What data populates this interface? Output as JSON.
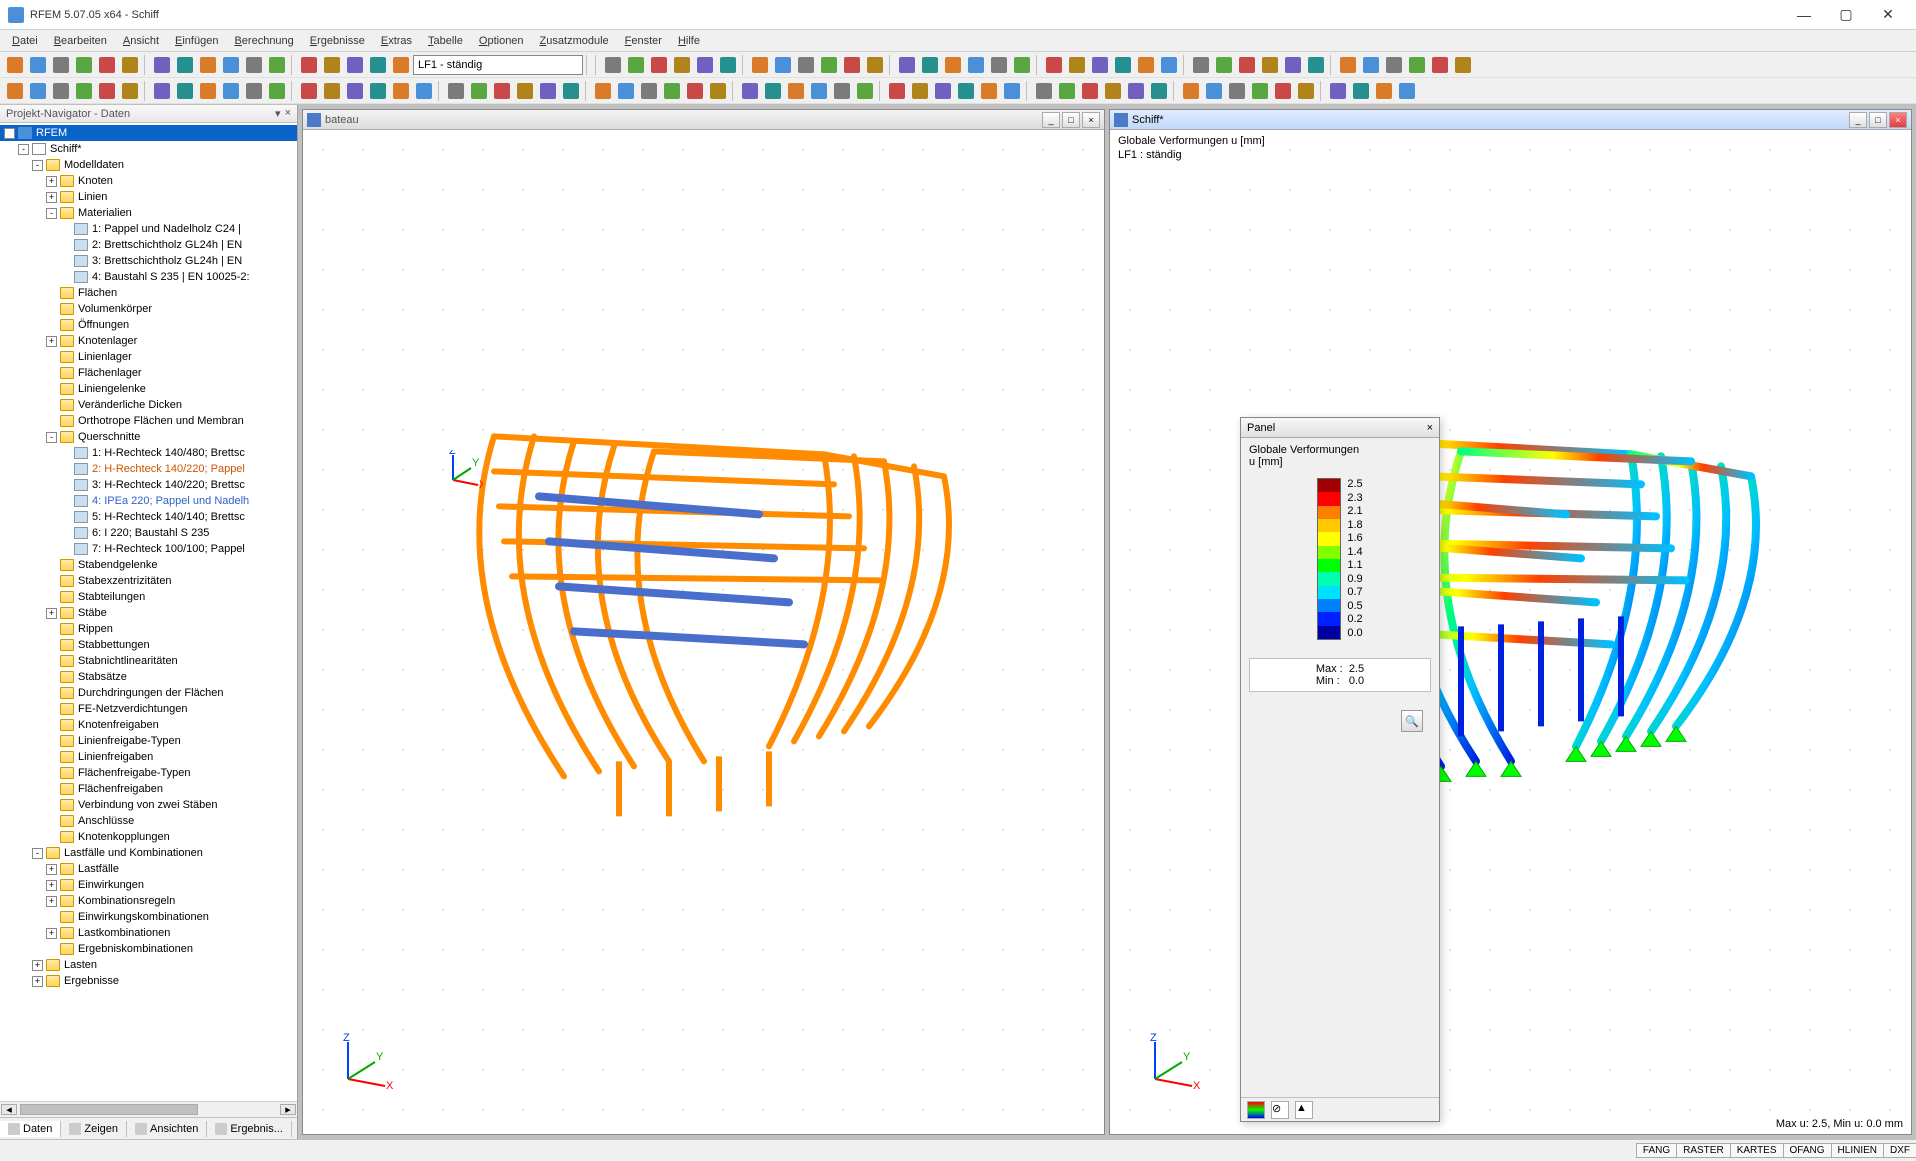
{
  "app": {
    "title": "RFEM 5.07.05 x64 - Schiff"
  },
  "menu": [
    "Datei",
    "Bearbeiten",
    "Ansicht",
    "Einfügen",
    "Berechnung",
    "Ergebnisse",
    "Extras",
    "Tabelle",
    "Optionen",
    "Zusatzmodule",
    "Fenster",
    "Hilfe"
  ],
  "toolbar_combo": "LF1 - ständig",
  "navigator": {
    "title": "Projekt-Navigator - Daten",
    "tabs": [
      "Daten",
      "Zeigen",
      "Ansichten",
      "Ergebnis..."
    ],
    "tree": [
      {
        "d": 0,
        "t": "-",
        "icon": "rfem",
        "label": "RFEM",
        "sel": true
      },
      {
        "d": 1,
        "t": "-",
        "icon": "model",
        "label": "Schiff*"
      },
      {
        "d": 2,
        "t": "-",
        "icon": "folder-open",
        "label": "Modelldaten"
      },
      {
        "d": 3,
        "t": "+",
        "icon": "folder",
        "label": "Knoten"
      },
      {
        "d": 3,
        "t": "+",
        "icon": "folder",
        "label": "Linien"
      },
      {
        "d": 3,
        "t": "-",
        "icon": "folder-open",
        "label": "Materialien"
      },
      {
        "d": 4,
        "t": "",
        "icon": "leaf",
        "label": "1: Pappel und Nadelholz C24 |"
      },
      {
        "d": 4,
        "t": "",
        "icon": "leaf",
        "label": "2: Brettschichtholz GL24h | EN"
      },
      {
        "d": 4,
        "t": "",
        "icon": "leaf",
        "label": "3: Brettschichtholz GL24h | EN"
      },
      {
        "d": 4,
        "t": "",
        "icon": "leaf",
        "label": "4: Baustahl S 235 | EN 10025-2:"
      },
      {
        "d": 3,
        "t": "",
        "icon": "folder",
        "label": "Flächen"
      },
      {
        "d": 3,
        "t": "",
        "icon": "folder",
        "label": "Volumenkörper"
      },
      {
        "d": 3,
        "t": "",
        "icon": "folder",
        "label": "Öffnungen"
      },
      {
        "d": 3,
        "t": "+",
        "icon": "folder",
        "label": "Knotenlager"
      },
      {
        "d": 3,
        "t": "",
        "icon": "folder",
        "label": "Linienlager"
      },
      {
        "d": 3,
        "t": "",
        "icon": "folder",
        "label": "Flächenlager"
      },
      {
        "d": 3,
        "t": "",
        "icon": "folder",
        "label": "Liniengelenke"
      },
      {
        "d": 3,
        "t": "",
        "icon": "folder",
        "label": "Veränderliche Dicken"
      },
      {
        "d": 3,
        "t": "",
        "icon": "folder",
        "label": "Orthotrope Flächen und Membran"
      },
      {
        "d": 3,
        "t": "-",
        "icon": "folder-open",
        "label": "Querschnitte"
      },
      {
        "d": 4,
        "t": "",
        "icon": "leaf",
        "label": "1: H-Rechteck 140/480; Brettsc"
      },
      {
        "d": 4,
        "t": "",
        "icon": "leaf",
        "label": "2: H-Rechteck 140/220; Pappel",
        "style": "color:#cc5500"
      },
      {
        "d": 4,
        "t": "",
        "icon": "leaf",
        "label": "3: H-Rechteck 140/220; Brettsc"
      },
      {
        "d": 4,
        "t": "",
        "icon": "leaf",
        "label": "4: IPEa 220; Pappel und Nadelh",
        "style": "color:#3060cc"
      },
      {
        "d": 4,
        "t": "",
        "icon": "leaf",
        "label": "5: H-Rechteck 140/140; Brettsc"
      },
      {
        "d": 4,
        "t": "",
        "icon": "leaf",
        "label": "6: I 220; Baustahl S 235"
      },
      {
        "d": 4,
        "t": "",
        "icon": "leaf",
        "label": "7: H-Rechteck 100/100; Pappel"
      },
      {
        "d": 3,
        "t": "",
        "icon": "folder",
        "label": "Stabendgelenke"
      },
      {
        "d": 3,
        "t": "",
        "icon": "folder",
        "label": "Stabexzentrizitäten"
      },
      {
        "d": 3,
        "t": "",
        "icon": "folder",
        "label": "Stabteilungen"
      },
      {
        "d": 3,
        "t": "+",
        "icon": "folder",
        "label": "Stäbe"
      },
      {
        "d": 3,
        "t": "",
        "icon": "folder",
        "label": "Rippen"
      },
      {
        "d": 3,
        "t": "",
        "icon": "folder",
        "label": "Stabbettungen"
      },
      {
        "d": 3,
        "t": "",
        "icon": "folder",
        "label": "Stabnichtlinearitäten"
      },
      {
        "d": 3,
        "t": "",
        "icon": "folder",
        "label": "Stabsätze"
      },
      {
        "d": 3,
        "t": "",
        "icon": "folder",
        "label": "Durchdringungen der Flächen"
      },
      {
        "d": 3,
        "t": "",
        "icon": "folder",
        "label": "FE-Netzverdichtungen"
      },
      {
        "d": 3,
        "t": "",
        "icon": "folder",
        "label": "Knotenfreigaben"
      },
      {
        "d": 3,
        "t": "",
        "icon": "folder",
        "label": "Linienfreigabe-Typen"
      },
      {
        "d": 3,
        "t": "",
        "icon": "folder",
        "label": "Linienfreigaben"
      },
      {
        "d": 3,
        "t": "",
        "icon": "folder",
        "label": "Flächenfreigabe-Typen"
      },
      {
        "d": 3,
        "t": "",
        "icon": "folder",
        "label": "Flächenfreigaben"
      },
      {
        "d": 3,
        "t": "",
        "icon": "folder",
        "label": "Verbindung von zwei Stäben"
      },
      {
        "d": 3,
        "t": "",
        "icon": "folder",
        "label": "Anschlüsse"
      },
      {
        "d": 3,
        "t": "",
        "icon": "folder",
        "label": "Knotenkopplungen"
      },
      {
        "d": 2,
        "t": "-",
        "icon": "folder-open",
        "label": "Lastfälle und Kombinationen"
      },
      {
        "d": 3,
        "t": "+",
        "icon": "folder",
        "label": "Lastfälle"
      },
      {
        "d": 3,
        "t": "+",
        "icon": "folder",
        "label": "Einwirkungen"
      },
      {
        "d": 3,
        "t": "+",
        "icon": "folder",
        "label": "Kombinationsregeln"
      },
      {
        "d": 3,
        "t": "",
        "icon": "folder",
        "label": "Einwirkungskombinationen"
      },
      {
        "d": 3,
        "t": "+",
        "icon": "folder",
        "label": "Lastkombinationen"
      },
      {
        "d": 3,
        "t": "",
        "icon": "folder",
        "label": "Ergebniskombinationen"
      },
      {
        "d": 2,
        "t": "+",
        "icon": "folder",
        "label": "Lasten"
      },
      {
        "d": 2,
        "t": "+",
        "icon": "folder",
        "label": "Ergebnisse"
      }
    ]
  },
  "viewports": {
    "left": {
      "title": "bateau"
    },
    "right": {
      "title": "Schiff*",
      "info_line1": "Globale Verformungen u [mm]",
      "info_line2": "LF1 : ständig",
      "footer": "Max u: 2.5, Min u: 0.0 mm"
    }
  },
  "panel": {
    "title": "Panel",
    "subtitle": "Globale Verformungen",
    "unit": "u [mm]",
    "scale": {
      "colors": [
        "#a00000",
        "#ff0000",
        "#ff8000",
        "#ffc800",
        "#ffff00",
        "#80ff00",
        "#00ff00",
        "#00ffb0",
        "#00e0ff",
        "#0080ff",
        "#0020ff",
        "#0000a0"
      ],
      "labels": [
        "2.5",
        "2.3",
        "2.1",
        "1.8",
        "1.6",
        "1.4",
        "1.1",
        "0.9",
        "0.7",
        "0.5",
        "0.2",
        "0.0"
      ]
    },
    "readout": {
      "max_label": "Max :",
      "max_value": "2.5",
      "min_label": "Min :",
      "min_value": "0.0"
    }
  },
  "statusbar": {
    "cells": [
      "FANG",
      "RASTER",
      "KARTES",
      "OFANG",
      "HLINIEN",
      "DXF"
    ]
  }
}
